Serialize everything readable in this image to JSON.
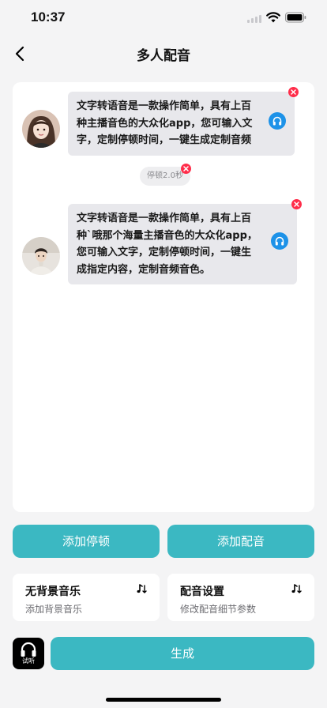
{
  "status_bar": {
    "time": "10:37"
  },
  "nav": {
    "title": "多人配音"
  },
  "segments": [
    {
      "text": "文字转语音是一款操作简单，具有上百\n种主播音色的大众化app，您可输入文\n字，定制停顿时间，一键生成定制音频"
    },
    {
      "pause_label": "停顿2.0秒"
    },
    {
      "text": "文字转语音是一款操作简单，具有上百\n种`哦那个海量主播音色的大众化app，\n您可输入文字，定制停顿时间，一键生\n成指定内容，定制音频音色。"
    }
  ],
  "actions": {
    "add_pause": "添加停顿",
    "add_voice": "添加配音"
  },
  "options": {
    "bgm": {
      "title": "无背景音乐",
      "subtitle": "添加背景音乐",
      "icon": "music-note-icon"
    },
    "voice_settings": {
      "title": "配音设置",
      "subtitle": "修改配音细节参数",
      "icon": "music-note-icon"
    }
  },
  "footer": {
    "trial_label": "试听",
    "generate_label": "生成"
  },
  "colors": {
    "accent": "#3bb8c2",
    "listen": "#1d92e8",
    "delete": "#ff2d4a",
    "background": "#f4f4f5"
  }
}
